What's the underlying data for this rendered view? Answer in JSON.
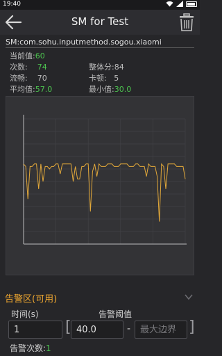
{
  "status_bar": {
    "time": "19:40"
  },
  "top_bar": {
    "title": "SM for Test",
    "back_icon": "back-arrow-icon",
    "delete_icon": "trash-icon"
  },
  "package_name": "SM:com.sohu.inputmethod.sogou.xiaomi",
  "stats": {
    "current_label": "当前值:",
    "current_value": "60",
    "count_label": "次数:",
    "count_value": "74",
    "score_label": "整体分:",
    "score_value": "84",
    "smooth_label": "流畅:",
    "smooth_value": "70",
    "lag_label": "卡顿:",
    "lag_value": "5",
    "avg_label": "平均值:",
    "avg_value": "57.0",
    "min_label": "最小值:",
    "min_value": "30.0"
  },
  "chart_data": {
    "type": "line",
    "series": [
      {
        "values": [
          57,
          56,
          43,
          56,
          56,
          57,
          57,
          47,
          57,
          50,
          56,
          56,
          55,
          56,
          56,
          57,
          57,
          53,
          57,
          57,
          57,
          57,
          57,
          50,
          56,
          51,
          51,
          56,
          56,
          57,
          57,
          38,
          54,
          57,
          52,
          57,
          56,
          56,
          56,
          57,
          57,
          57,
          56,
          56,
          56,
          57,
          57,
          57,
          57,
          56,
          56,
          56,
          57,
          57,
          56,
          56,
          56,
          52,
          57,
          56,
          56,
          56,
          52,
          34,
          57,
          56,
          47,
          57,
          57,
          57,
          57,
          56,
          56,
          56,
          56,
          51
        ]
      }
    ],
    "ylim": [
      25,
      75
    ],
    "grid": true,
    "color": "#e3a93a"
  },
  "alarm": {
    "title": "告警区(可用)",
    "time_label": "时间(s)",
    "threshold_label": "告警阈值",
    "time_value": "1",
    "min_value": "40.0",
    "max_placeholder": "最大边界",
    "left_bracket": "[",
    "dash": "-",
    "right_bracket": "]",
    "count_label": "告警次数:",
    "count_value": "1"
  },
  "colors": {
    "accent": "#f0a830",
    "good": "#4cc34f",
    "background": "#262629"
  }
}
